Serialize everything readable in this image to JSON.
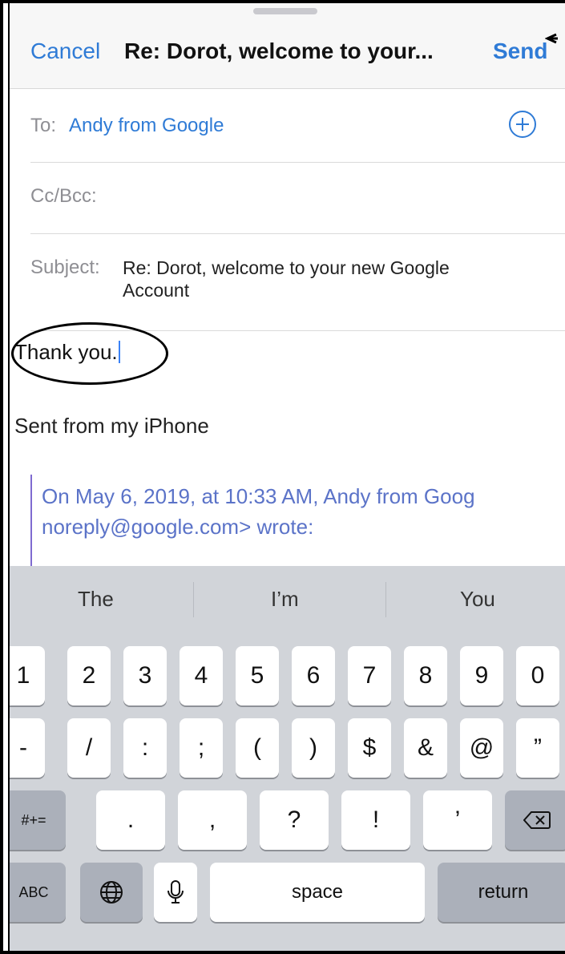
{
  "header": {
    "cancel_label": "Cancel",
    "title": "Re: Dorot, welcome to your...",
    "send_label": "Send"
  },
  "fields": {
    "to_label": "To:",
    "to_value": "Andy from Google",
    "cc_label": "Cc/Bcc:",
    "subject_label": "Subject:",
    "subject_value": "Re: Dorot, welcome to your new Google Account"
  },
  "body": {
    "text": "Thank you.",
    "signature": "Sent from my iPhone",
    "quote_line1": "On May 6, 2019, at 10:33 AM, Andy from Goog",
    "quote_line2": "noreply@google.com> wrote:"
  },
  "keyboard": {
    "suggestions": [
      "The",
      "I’m",
      "You"
    ],
    "row1": [
      "1",
      "2",
      "3",
      "4",
      "5",
      "6",
      "7",
      "8",
      "9",
      "0"
    ],
    "row2": [
      "-",
      "/",
      ":",
      ";",
      "(",
      ")",
      "$",
      "&",
      "@",
      "”"
    ],
    "row3_left": "#+=",
    "row3": [
      ".",
      ",",
      "?",
      "!",
      "’"
    ],
    "abc": "ABC",
    "space": "space",
    "return": "return",
    "icons": {
      "globe": "globe-icon",
      "mic": "microphone-icon",
      "delete": "backspace-icon",
      "add": "plus-circle-icon"
    }
  },
  "colors": {
    "accent": "#2f7bd6",
    "quote": "#5b73c8",
    "keyboard_bg": "#d1d4d9"
  }
}
